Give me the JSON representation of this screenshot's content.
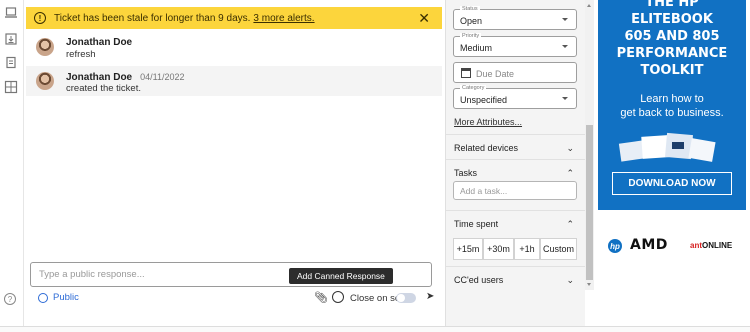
{
  "banner": {
    "text": "Ticket has been stale for longer than 9 days.",
    "link": "3 more alerts.",
    "icon": "warning-icon"
  },
  "messages": [
    {
      "author": "Jonathan Doe",
      "date": "",
      "body": "refresh"
    },
    {
      "author": "Jonathan Doe",
      "date": "04/11/2022",
      "body": "created the ticket."
    }
  ],
  "composer": {
    "placeholder": "Type a public response...",
    "visibility": "Public",
    "tooltip": "Add Canned Response",
    "close_on_send": "Close on send"
  },
  "panel": {
    "status": {
      "label": "Status",
      "value": "Open"
    },
    "priority": {
      "label": "Priority",
      "value": "Medium"
    },
    "due_date": {
      "placeholder": "Due Date"
    },
    "category": {
      "label": "Category",
      "value": "Unspecified"
    },
    "more_attributes": "More Attributes...",
    "related_devices": "Related devices",
    "tasks": {
      "title": "Tasks",
      "placeholder": "Add a task..."
    },
    "time_spent": {
      "title": "Time spent",
      "buttons": [
        "+15m",
        "+30m",
        "+1h",
        "Custom"
      ]
    },
    "ccd_users": "CC'ed users"
  },
  "ad": {
    "headline_lines": [
      "THE HP",
      "ELITEBOOK",
      "605 AND 805",
      "PERFORMANCE",
      "TOOLKIT"
    ],
    "sub_lines": [
      "Learn how to",
      "get back to business."
    ],
    "cta": "DOWNLOAD NOW",
    "logos": {
      "hp": "hp",
      "amd": "AMD",
      "ant_a": "ant",
      "ant_b": "ONLINE"
    }
  },
  "colors": {
    "banner": "#fcd53c",
    "ad_bg": "#1171c3",
    "link": "#2d6bd6"
  }
}
